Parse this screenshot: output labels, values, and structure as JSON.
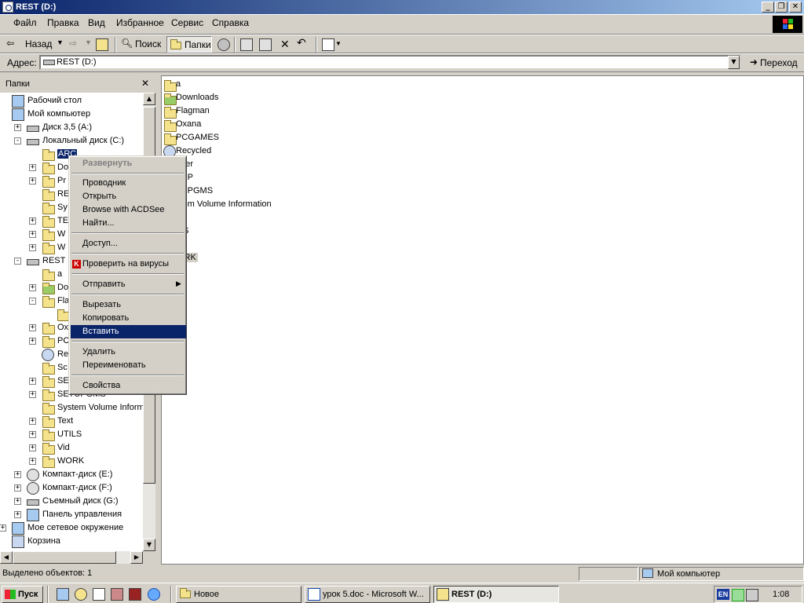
{
  "window": {
    "title": "REST (D:)"
  },
  "menu": [
    "Файл",
    "Правка",
    "Вид",
    "Избранное",
    "Сервис",
    "Справка"
  ],
  "toolbar": {
    "back": "Назад",
    "search": "Поиск",
    "folders": "Папки"
  },
  "address": {
    "label": "Адрес:",
    "value": "REST (D:)",
    "go": "Переход"
  },
  "folders_pane": {
    "title": "Папки",
    "tree": [
      {
        "label": "Рабочий стол",
        "icon": "desktop-icon"
      },
      {
        "label": "Мой компьютер",
        "icon": "computer-icon"
      },
      {
        "label": "Диск 3,5 (A:)",
        "icon": "floppy-icon"
      },
      {
        "label": "Локальный диск (C:)",
        "icon": "drive-icon"
      },
      {
        "label": "ARC",
        "icon": "folder-icon",
        "selected": true
      },
      {
        "label": "Do",
        "icon": "folder-icon"
      },
      {
        "label": "Pr",
        "icon": "folder-icon"
      },
      {
        "label": "RE",
        "icon": "folder-icon"
      },
      {
        "label": "Sy",
        "icon": "folder-icon"
      },
      {
        "label": "TE",
        "icon": "folder-icon"
      },
      {
        "label": "W",
        "icon": "folder-icon"
      },
      {
        "label": "W",
        "icon": "folder-icon"
      },
      {
        "label": "REST",
        "icon": "drive-icon"
      },
      {
        "label": "a",
        "icon": "folder-icon"
      },
      {
        "label": "Do",
        "icon": "downloads-folder-icon"
      },
      {
        "label": "Fla",
        "icon": "folder-icon"
      },
      {
        "label": "",
        "icon": "folder-icon"
      },
      {
        "label": "Ox",
        "icon": "folder-icon"
      },
      {
        "label": "PC",
        "icon": "folder-icon"
      },
      {
        "label": "Re",
        "icon": "recycle-icon"
      },
      {
        "label": "Sc",
        "icon": "folder-icon"
      },
      {
        "label": "SE",
        "icon": "folder-icon"
      },
      {
        "label": "SETUPGMS",
        "icon": "folder-icon"
      },
      {
        "label": "System Volume Inform",
        "icon": "folder-icon"
      },
      {
        "label": "Text",
        "icon": "folder-icon"
      },
      {
        "label": "UTILS",
        "icon": "folder-icon"
      },
      {
        "label": "Vid",
        "icon": "folder-icon"
      },
      {
        "label": "WORK",
        "icon": "folder-icon"
      },
      {
        "label": "Компакт-диск (E:)",
        "icon": "cdrom-icon"
      },
      {
        "label": "Компакт-диск (F:)",
        "icon": "cdrom-icon"
      },
      {
        "label": "Съемный диск (G:)",
        "icon": "removable-drive-icon"
      },
      {
        "label": "Панель управления",
        "icon": "control-panel-icon"
      },
      {
        "label": "Мое сетевое окружение",
        "icon": "network-icon"
      },
      {
        "label": "Корзина",
        "icon": "recycle-bin-icon"
      }
    ]
  },
  "files": [
    {
      "label": "a"
    },
    {
      "label": "Downloads"
    },
    {
      "label": "Flagman"
    },
    {
      "label": "Oxana"
    },
    {
      "label": "PCGAMES"
    },
    {
      "label": "Recycled"
    },
    {
      "label": "aner"
    },
    {
      "label": "TUP"
    },
    {
      "label": "TUPGMS"
    },
    {
      "label": "stem Volume Information"
    },
    {
      "label": "xt"
    },
    {
      "label": "ILS"
    },
    {
      "label": ""
    },
    {
      "label": "ORK"
    }
  ],
  "context_menu": {
    "items": [
      "Развернуть",
      "Проводник",
      "Открыть",
      "Browse with ACDSee",
      "Найти...",
      "Доступ...",
      "Проверить на вирусы",
      "Отправить",
      "Вырезать",
      "Копировать",
      "Вставить",
      "Удалить",
      "Переименовать",
      "Свойства"
    ],
    "highlighted": "Вставить",
    "disabled": "Развернуть"
  },
  "status": {
    "left": "Выделено объектов: 1",
    "right": "Мой компьютер"
  },
  "taskbar": {
    "start": "Пуск",
    "tasks": [
      "Новое",
      "урок 5.doc - Microsoft W...",
      "REST (D:)"
    ],
    "active": "REST (D:)",
    "lang": "EN",
    "clock": "1:08"
  },
  "colors": {
    "title_start": "#0a246a",
    "title_end": "#a6caf0",
    "highlight": "#0a246a",
    "face": "#d4d0c8"
  }
}
